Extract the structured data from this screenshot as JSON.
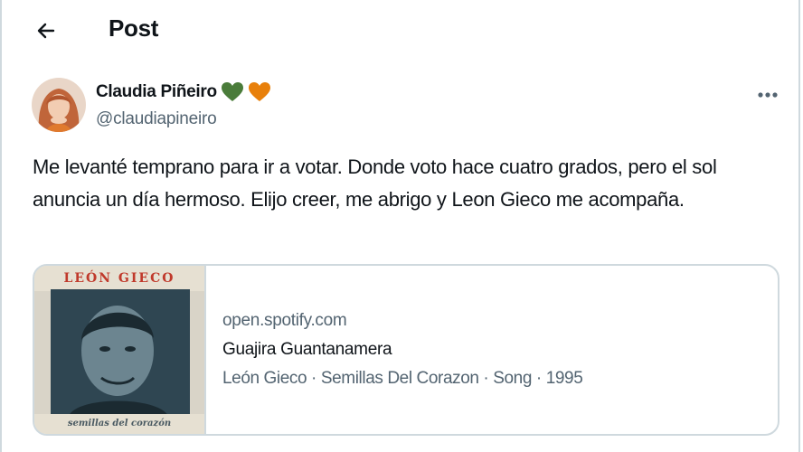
{
  "header": {
    "title": "Post"
  },
  "post": {
    "author_name": "Claudia Piñeiro",
    "author_handle": "@claudiapineiro",
    "badges": [
      {
        "icon": "green-heart-icon",
        "color": "#4a7c3a"
      },
      {
        "icon": "orange-heart-icon",
        "color": "#e8800b"
      }
    ],
    "text": "Me levanté temprano para ir a votar. Donde voto hace cuatro grados, pero el sol anuncia un día hermoso. Elijo creer, me abrigo y Leon Gieco me acompaña."
  },
  "link_card": {
    "domain": "open.spotify.com",
    "title": "Guajira Guantanamera",
    "description": "León Gieco · Semillas Del Corazon · Song · 1995",
    "album_title": "LEÓN GIECO",
    "album_subtitle": "semillas del corazón"
  },
  "colors": {
    "border": "#cfd9de",
    "text": "#0f1419",
    "secondary": "#536471"
  }
}
